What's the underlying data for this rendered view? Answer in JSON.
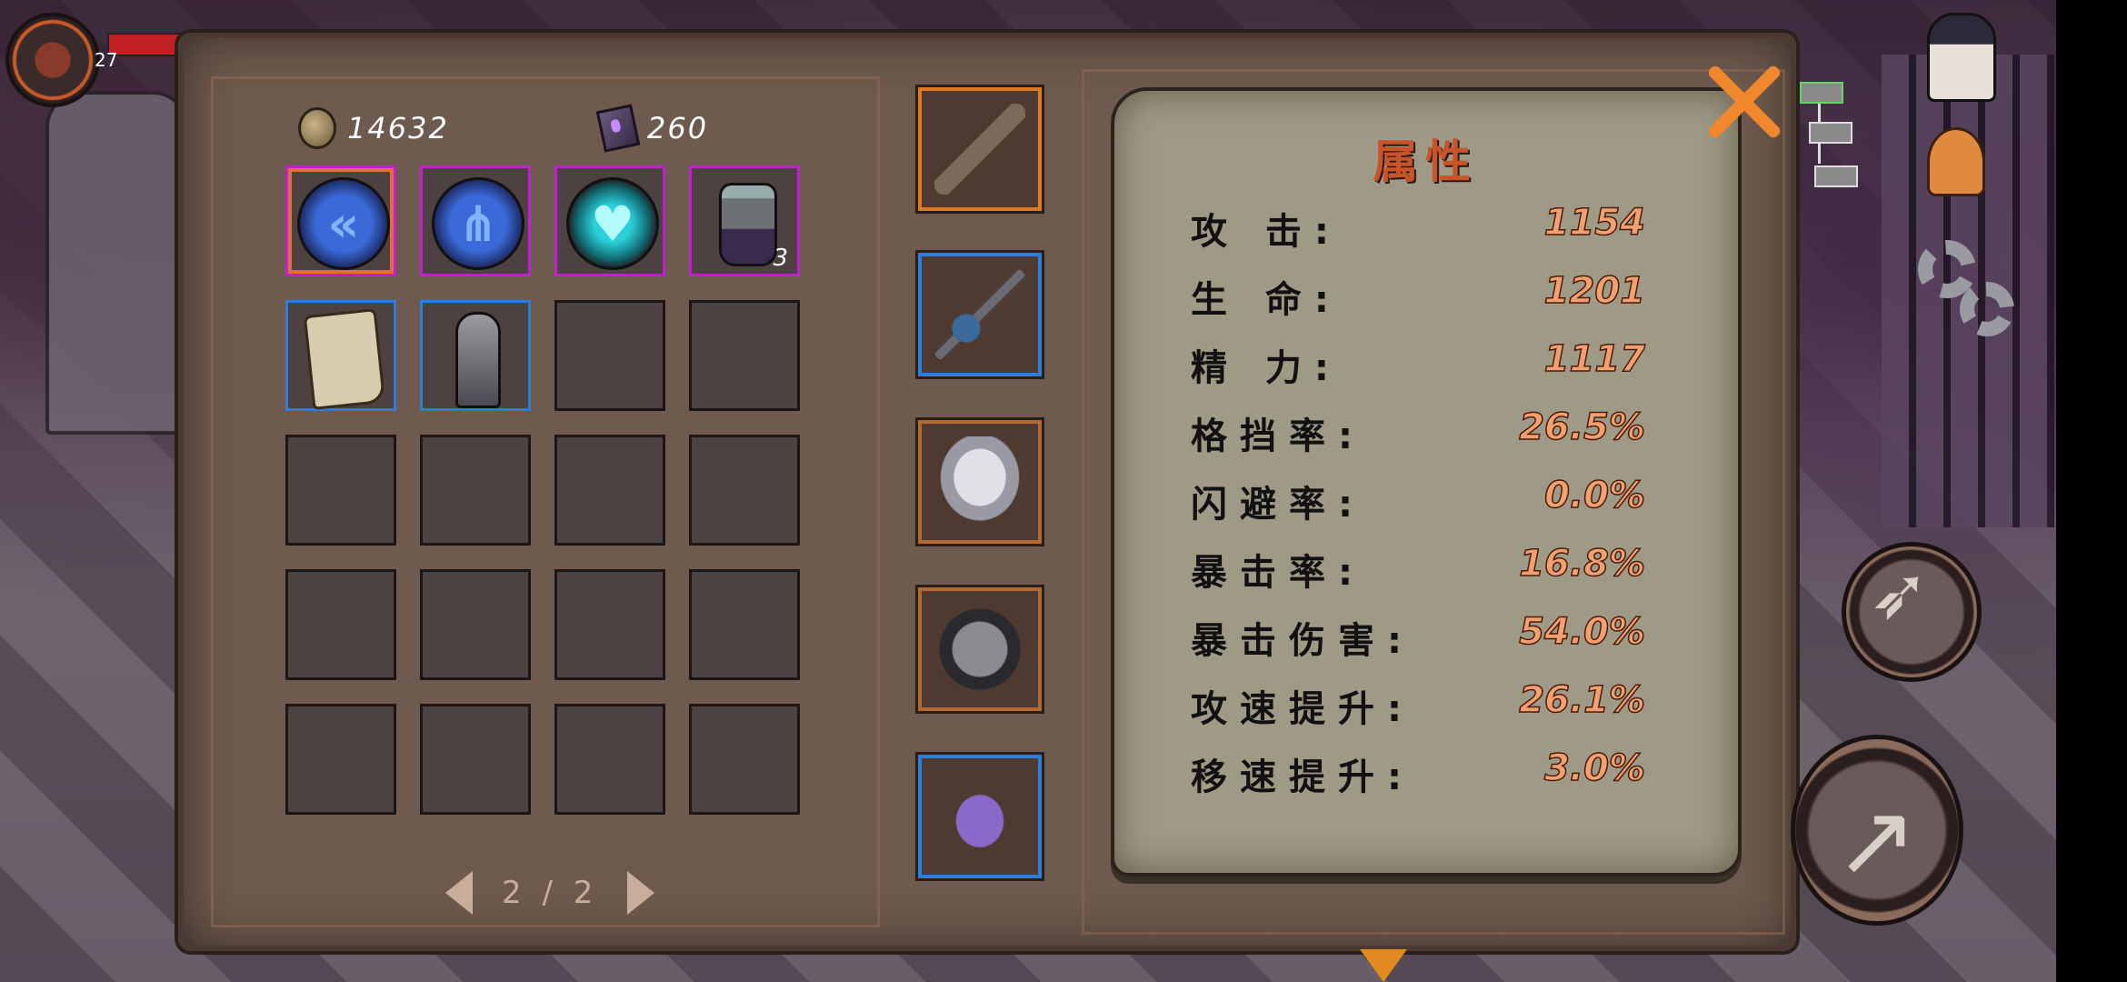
{
  "hud": {
    "player_level": "27"
  },
  "currencies": {
    "coins": "14632",
    "tomes": "260"
  },
  "inventory": {
    "slots": [
      {
        "item": "chevron-rune-emblem",
        "rarity": "epic",
        "selected": true
      },
      {
        "item": "branch-rune-emblem",
        "rarity": "epic"
      },
      {
        "item": "heart-rune-emblem",
        "rarity": "epic"
      },
      {
        "item": "potion-jar",
        "rarity": "epic",
        "count": "3"
      },
      {
        "item": "parchment-scroll",
        "rarity": "rare"
      },
      {
        "item": "stone-statue",
        "rarity": "rare"
      }
    ],
    "pager": {
      "text": "2 / 2"
    }
  },
  "equipment": [
    {
      "slot": "weapon",
      "item": "spear-weapon",
      "rarity": "orange"
    },
    {
      "slot": "offhand",
      "item": "spiked-mace",
      "rarity": "blue"
    },
    {
      "slot": "head",
      "item": "veiled-mask",
      "rarity": "tan"
    },
    {
      "slot": "chest",
      "item": "skull-armor",
      "rarity": "tan"
    },
    {
      "slot": "feet",
      "item": "purple-boots",
      "rarity": "blue"
    }
  ],
  "stats": {
    "title": "属性",
    "rows": [
      {
        "label": "攻 击:",
        "value": "1154"
      },
      {
        "label": "生 命:",
        "value": "1201"
      },
      {
        "label": "精 力:",
        "value": "1117"
      },
      {
        "label": "格挡率:",
        "value": "26.5%"
      },
      {
        "label": "闪避率:",
        "value": "0.0%"
      },
      {
        "label": "暴击率:",
        "value": "16.8%"
      },
      {
        "label": "暴击伤害:",
        "value": "54.0%"
      },
      {
        "label": "攻速提升:",
        "value": "26.1%"
      },
      {
        "label": "移速提升:",
        "value": "3.0%"
      }
    ]
  },
  "colors": {
    "panel": "#6e5a4e",
    "parchment": "#9e9a86",
    "title_accent": "#c9542a",
    "value_accent": "#f2a070",
    "epic_border": "#c21fd0",
    "rare_border": "#2e7dd8",
    "close_accent": "#f0862e"
  },
  "icons": {
    "coin": "coin-icon",
    "tome": "tome-icon",
    "close": "close-icon",
    "settings": "gear-icon",
    "hero": "hero-portrait-icon",
    "bell": "bell-icon",
    "prev": "chevron-left-icon",
    "next": "chevron-right-icon"
  }
}
